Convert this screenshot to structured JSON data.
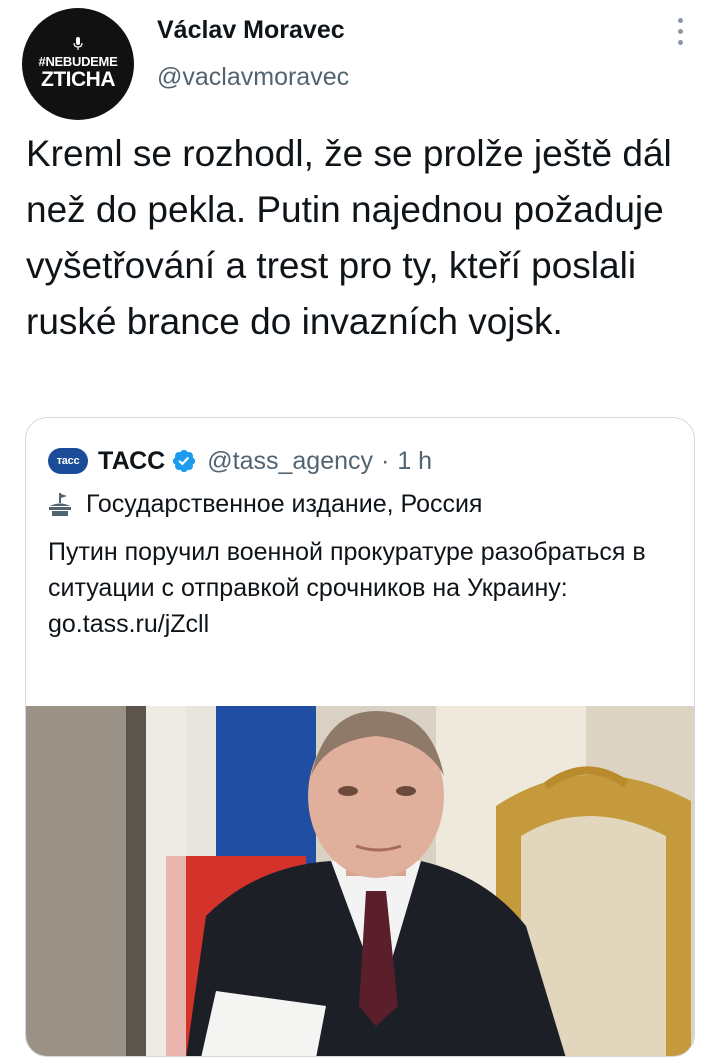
{
  "author": {
    "avatar_line1": "#NEBUDEME",
    "avatar_line2": "ZTICHA",
    "name": "Václav Moravec",
    "handle": "@vaclavmoravec"
  },
  "tweet": {
    "text": "Kreml se rozhodl, že se prolže ještě dál než do pekla. Putin najednou požaduje vyšetřování a trest pro ty, kteří poslali ruské brance do invazních vojsk."
  },
  "quoted": {
    "logo_text": "тасс",
    "name": "ТАСС",
    "handle": "@tass_agency",
    "separator": "·",
    "time": "1 h",
    "label": "Государственное издание, Россия",
    "text": "Путин поручил военной прокуратуре разобраться в ситуации с отправкой срочников на Украину:",
    "link": "go.tass.ru/jZcll"
  },
  "colors": {
    "verified": "#1d9bf0",
    "secondary_text": "#536471",
    "border": "#cfd9de"
  }
}
